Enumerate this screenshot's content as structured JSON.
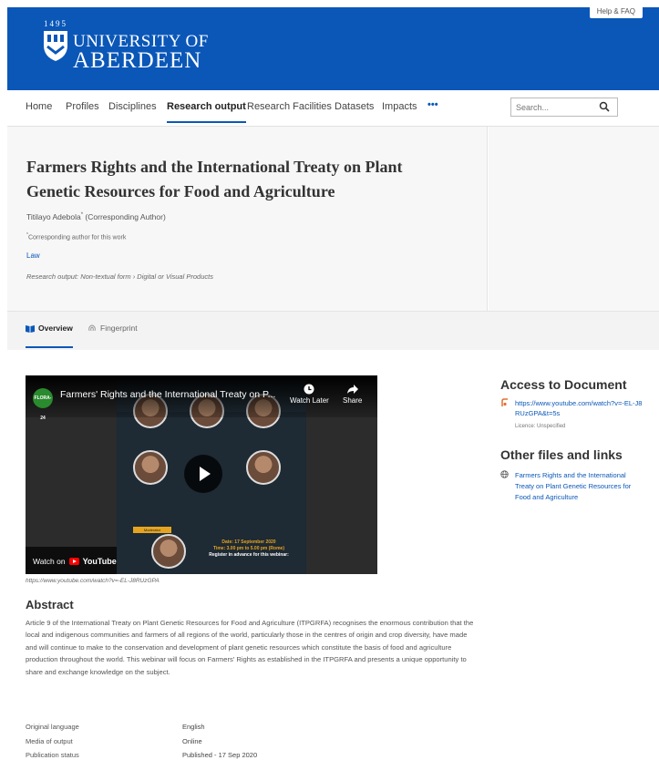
{
  "header": {
    "help_label": "Help & FAQ",
    "logo_year": "1495",
    "logo_line1": "UNIVERSITY OF",
    "logo_line2": "ABERDEEN",
    "brand_color": "#0a57b8"
  },
  "nav": {
    "items": [
      {
        "label": "Home"
      },
      {
        "label": "Profiles"
      },
      {
        "label": "Disciplines"
      },
      {
        "label": "Research output",
        "active": true
      },
      {
        "label": "Research Facilities"
      },
      {
        "label": "Datasets"
      },
      {
        "label": "Impacts"
      },
      {
        "label": "•••"
      }
    ],
    "search_placeholder": "Search..."
  },
  "record": {
    "title": "Farmers Rights and the International Treaty on Plant Genetic Resources for Food and Agriculture",
    "author": "Titilayo Adebola",
    "author_marker": "*",
    "author_role": "(Corresponding Author)",
    "note_marker": "*",
    "note": "Corresponding author for this work",
    "discipline": "Law",
    "output_type": "Research output: Non-textual form › Digital or Visual Products"
  },
  "tabs": [
    {
      "label": "Overview",
      "icon": "book-icon",
      "active": true
    },
    {
      "label": "Fingerprint",
      "icon": "fingerprint-icon"
    }
  ],
  "video": {
    "channel": "FLORA-24",
    "title": "Farmers' Rights and the International Treaty on P...",
    "watch_later": "Watch Later",
    "share": "Share",
    "watch_on": "Watch on",
    "youtube": "YouTube",
    "date_text": "Date: 17 September 2020",
    "time_text": "Time: 3.00 pm to 5.00 pm (Rome)",
    "register_text": "Register in advance for this webinar:",
    "moderator": "Moderator",
    "url_caption": "https://www.youtube.com/watch?v=-EL-J8RUzGPA"
  },
  "abstract": {
    "heading": "Abstract",
    "text": "Article 9 of the International Treaty on Plant Genetic Resources for Food and Agriculture (ITPGRFA) recognises the enormous contribution that the local and indigenous communities and farmers of all regions of the world, particularly those in the centres of origin and crop diversity, have made and will continue to make to the conservation and development of plant genetic resources which constitute the basis of food and agriculture production throughout the world. This webinar will focus on Farmers' Rights as established in the ITPGRFA and presents a unique opportunity to share and exchange knowledge on the subject."
  },
  "access": {
    "heading": "Access to Document",
    "link": "https://www.youtube.com/watch?v=-EL-J8RUzGPA&t=5s",
    "license": "Licence: Unspecified"
  },
  "other": {
    "heading": "Other files and links",
    "link": "Farmers Rights and the International Treaty on Plant Genetic Resources for Food and Agriculture"
  },
  "metadata": [
    {
      "key": "Original language",
      "value": "English"
    },
    {
      "key": "Media of output",
      "value": "Online"
    },
    {
      "key": "Publication status",
      "value": "Published - 17 Sep 2020"
    }
  ]
}
